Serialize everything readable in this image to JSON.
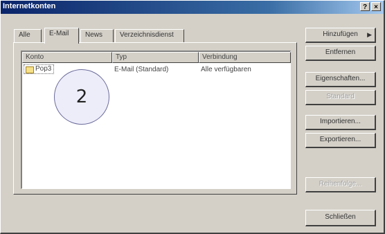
{
  "window": {
    "title": "Internetkonten",
    "help_label": "?",
    "close_label": "×"
  },
  "tabs": [
    {
      "label": "Alle",
      "active": false
    },
    {
      "label": "E-Mail",
      "active": true
    },
    {
      "label": "News",
      "active": false
    },
    {
      "label": "Verzeichnisdienst",
      "active": false
    }
  ],
  "list": {
    "columns": [
      "Konto",
      "Typ",
      "Verbindung"
    ],
    "rows": [
      {
        "konto": "Pop3",
        "typ": "E-Mail (Standard)",
        "verbindung": "Alle verfügbaren"
      }
    ]
  },
  "buttons": {
    "add": "Hinzufügen",
    "remove": "Entfernen",
    "properties": "Eigenschaften...",
    "default": "Standard",
    "import": "Importieren...",
    "export": "Exportieren...",
    "order": "Reihenfolge...",
    "close": "Schließen"
  },
  "callout": {
    "label": "2"
  }
}
